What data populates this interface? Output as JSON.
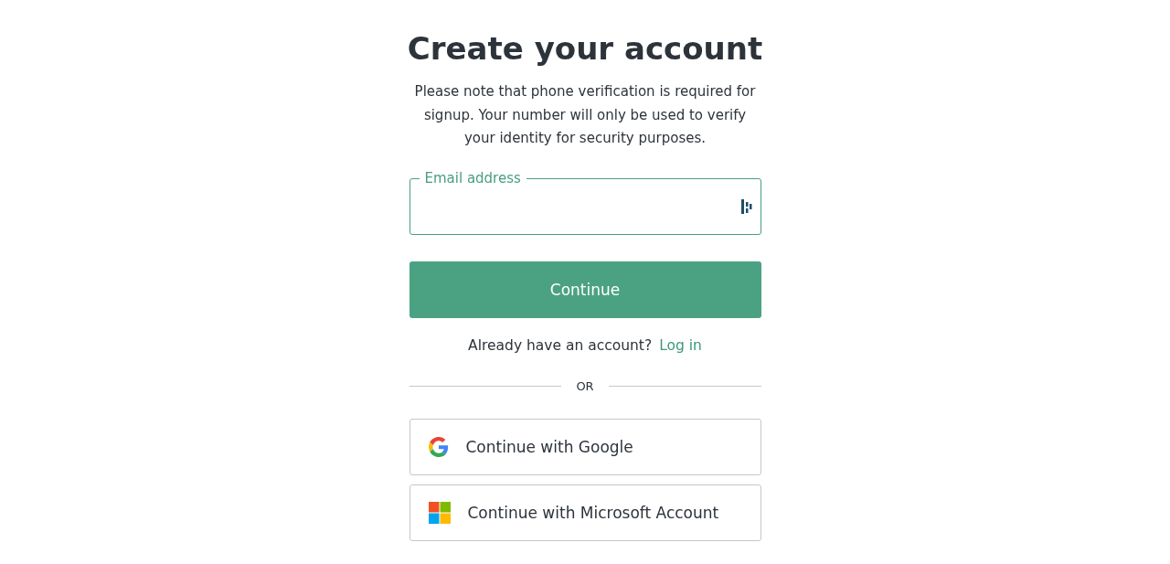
{
  "title": "Create your account",
  "description": "Please note that phone verification is required for signup. Your number will only be used to verify your identity for security purposes.",
  "email_field": {
    "label": "Email address",
    "focused": true
  },
  "continue_button": "Continue",
  "login_prompt": {
    "text": "Already have an account?",
    "link": "Log in"
  },
  "divider": "OR",
  "social_buttons": [
    {
      "kind": "google",
      "label": "Continue with Google"
    },
    {
      "kind": "microsoft",
      "label": "Continue with Microsoft Account"
    }
  ]
}
